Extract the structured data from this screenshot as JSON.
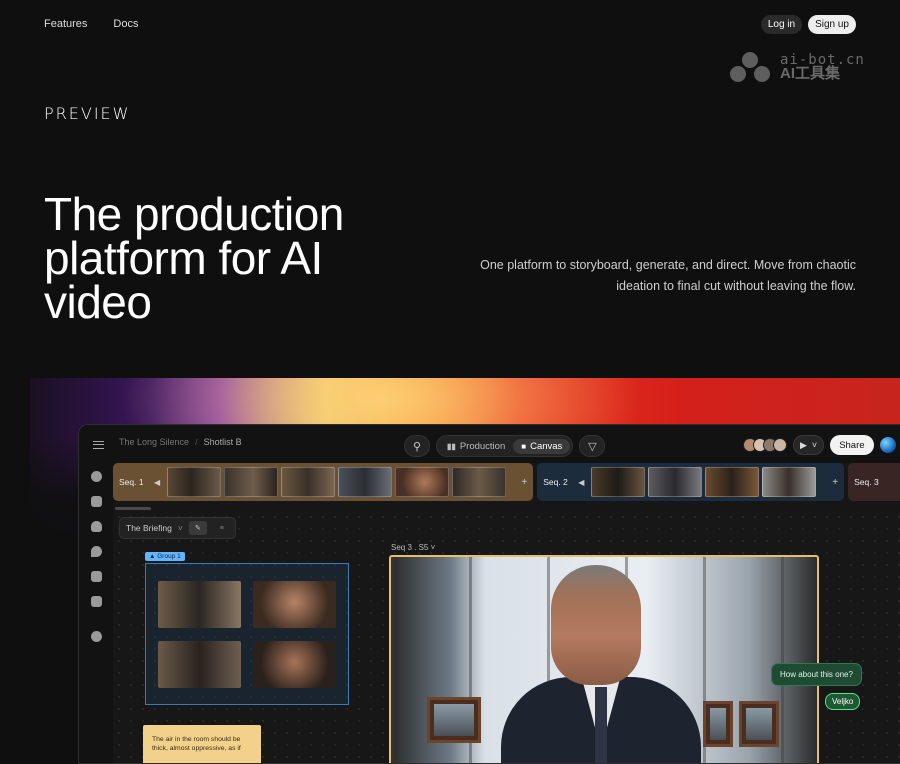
{
  "nav": {
    "features": "Features",
    "docs": "Docs",
    "login": "Log in",
    "signup": "Sign up"
  },
  "watermark": {
    "line1": "ai-bot.cn",
    "line2": "AI工具集"
  },
  "brand": {
    "logo": "PREVIEW"
  },
  "hero": {
    "title": "The production platform for AI video",
    "subtitle": "One platform to storyboard, generate, and direct. Move from chaotic ideation to final cut without leaving the flow."
  },
  "app": {
    "breadcrumb": {
      "project": "The Long Silence",
      "sep": "/",
      "current": "Shotlist B"
    },
    "view_tabs": [
      {
        "label": "Production",
        "active": false
      },
      {
        "label": "Canvas",
        "active": true
      }
    ],
    "share": "Share",
    "sequences": [
      {
        "label": "Seq. 1",
        "thumbs": 6
      },
      {
        "label": "Seq. 2",
        "thumbs": 4
      },
      {
        "label": "Seq. 3",
        "thumbs": 0
      }
    ],
    "briefing": "The Briefing",
    "group_label": "Group 1",
    "note": "The air in the room should be thick, almost oppressive, as if",
    "shot_label": "Seq 3 . S5",
    "chat_message": "How about this one?",
    "chat_user": "Veljko",
    "colors": {
      "group_border": "#3c7bb0",
      "shot_border": "#e7bf6a",
      "note_bg": "#f2d18b",
      "chat_bg": "#1f4b34"
    }
  }
}
